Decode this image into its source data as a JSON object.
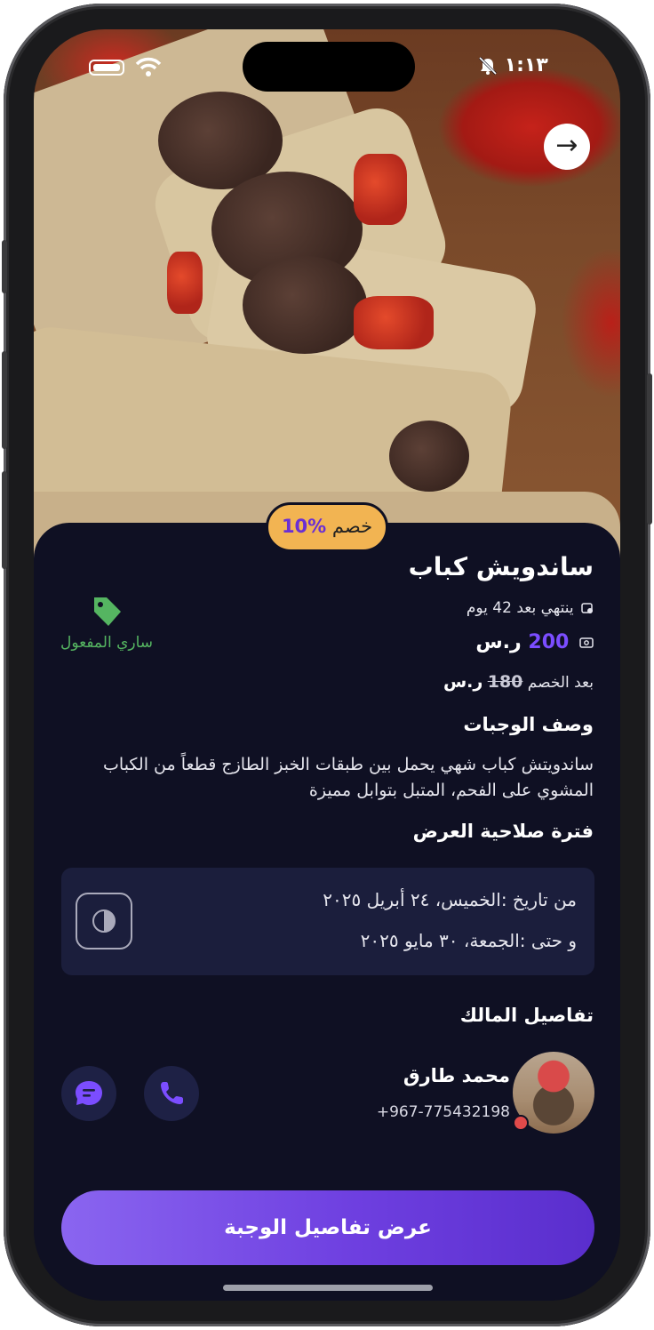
{
  "status_bar": {
    "time": "١:١٣"
  },
  "meal": {
    "discount_label": "خصم",
    "discount_value": "10%",
    "title": "ساندويش كباب",
    "ends_text": "ينتهي بعد 42 يوم",
    "price_value": "200",
    "currency": "ر.س",
    "after_discount_label": "بعد الخصم",
    "after_discount_value": "180",
    "validity_status": "ساري المفعول"
  },
  "description": {
    "heading": "وصف الوجبات",
    "text": "ساندويتش كباب شهي يحمل بين طبقات الخبز الطازج قطعاً من الكباب المشوي على الفحم، المتبل بتوابل مميزة"
  },
  "period": {
    "heading": "فترة صلاحية العرض",
    "from": "من تاريخ :الخميس، ٢٤ أبريل ٢٠٢٥",
    "to": "و حتى :الجمعة، ٣٠ مايو ٢٠٢٥"
  },
  "owner": {
    "heading": "تفاصيل المالك",
    "name": "محمد طارق",
    "phone": "+967-775432198"
  },
  "cta_label": "عرض تفاصيل الوجبة",
  "colors": {
    "accent": "#7b4dff",
    "badge": "#f2b452",
    "valid": "#55b561",
    "background": "#0f1023"
  }
}
